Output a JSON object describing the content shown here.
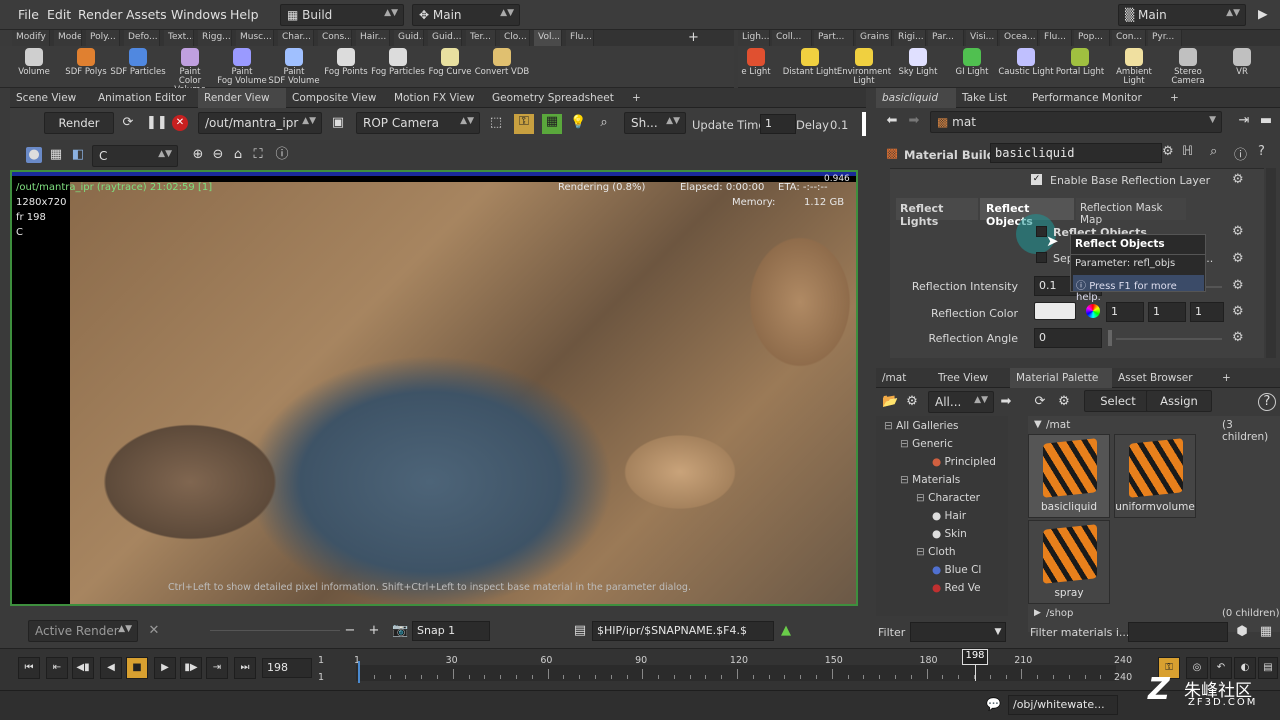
{
  "menu": {
    "items": [
      "File",
      "Edit",
      "Render",
      "Assets",
      "Windows",
      "Help"
    ],
    "desktop": "Build",
    "context": "Main",
    "workspace": "Main"
  },
  "shelf_tabs_left": [
    "Modify",
    "Model",
    "Poly...",
    "Defo...",
    "Text...",
    "Rigg...",
    "Musc...",
    "Char...",
    "Cons...",
    "Hair...",
    "Guid...",
    "Guid...",
    "Ter...",
    "Clo...",
    "Vol...",
    "Flu..."
  ],
  "shelf_tabs_right": [
    "Ligh...",
    "Coll...",
    "Part...",
    "Grains",
    "Rigi...",
    "Par...",
    "Visi...",
    "Ocea...",
    "Flu...",
    "Pop...",
    "Con...",
    "Pyr..."
  ],
  "tools_left": [
    {
      "l1": "Volume",
      "l2": ""
    },
    {
      "l1": "SDF Polys",
      "l2": ""
    },
    {
      "l1": "SDF Particles",
      "l2": ""
    },
    {
      "l1": "Paint",
      "l2": "Color Volume"
    },
    {
      "l1": "Paint",
      "l2": "Fog Volume"
    },
    {
      "l1": "Paint",
      "l2": "SDF Volume"
    },
    {
      "l1": "Fog Points",
      "l2": ""
    },
    {
      "l1": "Fog Particles",
      "l2": ""
    },
    {
      "l1": "Fog Curve",
      "l2": ""
    },
    {
      "l1": "Convert VDB",
      "l2": ""
    }
  ],
  "tools_right": [
    {
      "l1": "e Light",
      "l2": ""
    },
    {
      "l1": "Distant Light",
      "l2": ""
    },
    {
      "l1": "Environment",
      "l2": "Light"
    },
    {
      "l1": "Sky Light",
      "l2": ""
    },
    {
      "l1": "GI Light",
      "l2": ""
    },
    {
      "l1": "Caustic Light",
      "l2": ""
    },
    {
      "l1": "Portal Light",
      "l2": ""
    },
    {
      "l1": "Ambient Light",
      "l2": ""
    },
    {
      "l1": "Stereo",
      "l2": "Camera"
    },
    {
      "l1": "VR",
      "l2": ""
    }
  ],
  "left_tabs": [
    "Scene View",
    "Animation Editor",
    "Render View",
    "Composite View",
    "Motion FX View",
    "Geometry Spreadsheet"
  ],
  "render_toolbar": {
    "render": "Render",
    "rop_path": "/out/mantra_ipr",
    "camera": "ROP Camera",
    "sh": "Sh...",
    "update_time_label": "Update Time",
    "update_time": "1",
    "delay_label": "Delay",
    "delay": "0.1"
  },
  "viewer_toolbar": {
    "channel": "C"
  },
  "hud": {
    "path": "/out/mantra_ipr (raytrace) 21:02:59 [1]",
    "res": "1280x720",
    "frame": "fr 198",
    "channel": "C",
    "rendering": "Rendering (0.8%)",
    "elapsed": "Elapsed: 0:00:00",
    "eta": "ETA: -:--:--",
    "memory_label": "Memory:",
    "memory": "1.12 GB",
    "corner": "0.946",
    "hint": "Ctrl+Left to show detailed pixel information. Shift+Ctrl+Left to inspect base material in the parameter dialog."
  },
  "viewer_bottom": {
    "active_render": "Active Render",
    "snap": "Snap 1",
    "snap_path": "$HIP/ipr/$SNAPNAME.$F4.$"
  },
  "right_tabs": [
    "basicliquid",
    "Take List",
    "Performance Monitor"
  ],
  "param": {
    "path": "mat",
    "node_type": "Material Builder",
    "node_name": "basicliquid",
    "enable_base": "Enable Base Reflection Layer",
    "subtabs": [
      "Reflect Lights",
      "Reflect Objects",
      "Reflection Mask Map"
    ],
    "reflect_objects": "Reflect Objects",
    "sep": "Sep",
    "sep_tail": "a...",
    "intensity_label": "Reflection Intensity",
    "intensity": "0.1",
    "color_label": "Reflection Color",
    "color_r": "1",
    "color_g": "1",
    "color_b": "1",
    "angle_label": "Reflection Angle",
    "angle": "0"
  },
  "tooltip": {
    "title": "Reflect Objects",
    "param": "Parameter: refl_objs",
    "help": "Press F1 for more help."
  },
  "mat_tabs": [
    "/mat",
    "Tree View",
    "Material Palette",
    "Asset Browser"
  ],
  "palette": {
    "filter_all": "All...",
    "select": "Select",
    "assign": "Assign",
    "path": "/mat",
    "children": "(3 children)",
    "shop": "/shop",
    "shop_children": "(0 children)",
    "filter_label": "Filter",
    "filter_placeholder": "Filter materials i..."
  },
  "tree": [
    {
      "t": "All Galleries",
      "lvl": 0
    },
    {
      "t": "Generic",
      "lvl": 1
    },
    {
      "t": "Principled",
      "lvl": 3
    },
    {
      "t": "Materials",
      "lvl": 1
    },
    {
      "t": "Character",
      "lvl": 2
    },
    {
      "t": "Hair",
      "lvl": 3
    },
    {
      "t": "Skin",
      "lvl": 3
    },
    {
      "t": "Cloth",
      "lvl": 2
    },
    {
      "t": "Blue Cl",
      "lvl": 3
    },
    {
      "t": "Red Ve",
      "lvl": 3
    }
  ],
  "materials": [
    "basicliquid",
    "uniformvolume",
    "spray"
  ],
  "playbar": {
    "frame": "198",
    "start1": "1",
    "start2": "1",
    "end1": "240",
    "end2": "240",
    "current": "198",
    "ticks": [
      "1",
      "30",
      "60",
      "90",
      "120",
      "150",
      "180",
      "210"
    ]
  },
  "status": {
    "path": "/obj/whitewate..."
  },
  "watermark": {
    "cn": "朱峰社区",
    "url": "ZF3D.COM"
  }
}
